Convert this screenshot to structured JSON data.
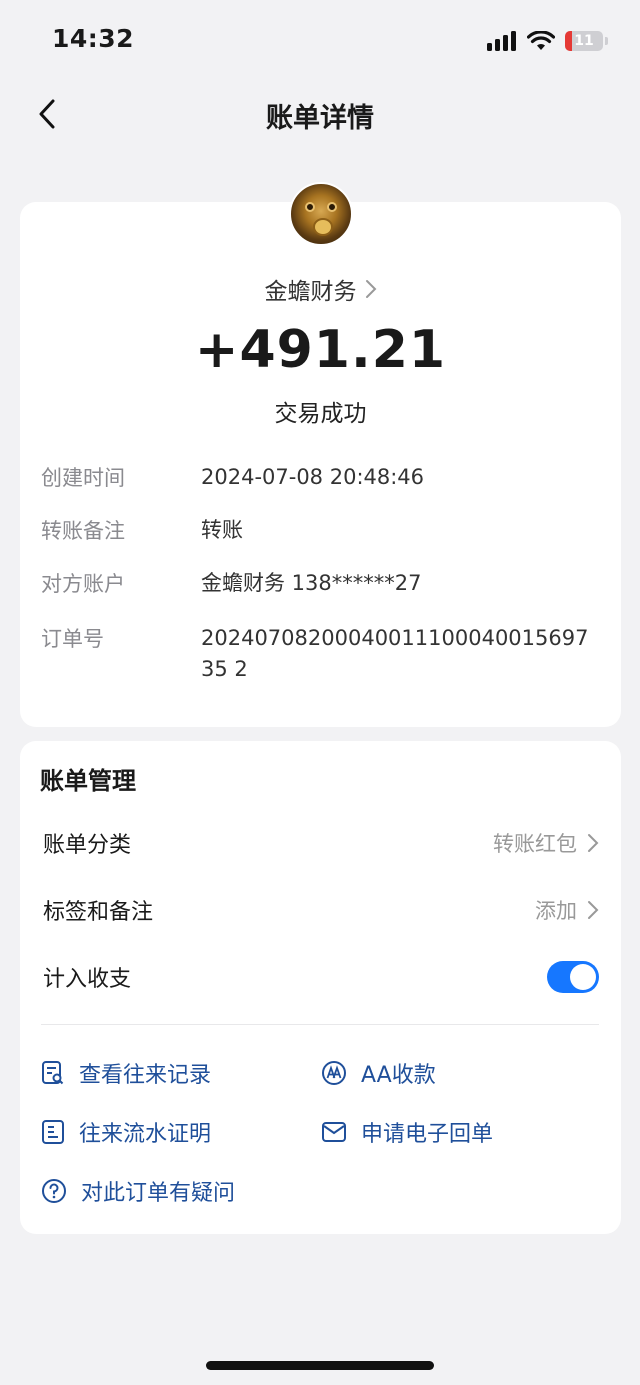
{
  "status_bar": {
    "time": "14:32",
    "battery": "11"
  },
  "nav": {
    "title": "账单详情"
  },
  "transaction": {
    "merchant": "金蟾财务",
    "amount": "+491.21",
    "status": "交易成功",
    "details": [
      {
        "label": "创建时间",
        "value": "2024-07-08 20:48:46"
      },
      {
        "label": "转账备注",
        "value": "转账"
      },
      {
        "label": "对方账户",
        "value": "金蟾财务 138******27"
      },
      {
        "label": "订单号",
        "value": "2024070820004001110004001569735 2"
      }
    ]
  },
  "management": {
    "title": "账单管理",
    "category": {
      "label": "账单分类",
      "value": "转账红包"
    },
    "tags": {
      "label": "标签和备注",
      "value": "添加"
    },
    "include": {
      "label": "计入收支",
      "enabled": true
    }
  },
  "actions": {
    "records": "查看往来记录",
    "aa": "AA收款",
    "statement": "往来流水证明",
    "receipt": "申请电子回单",
    "question": "对此订单有疑问"
  },
  "colors": {
    "accent": "#1677ff",
    "action_text": "#1f4f9a"
  }
}
